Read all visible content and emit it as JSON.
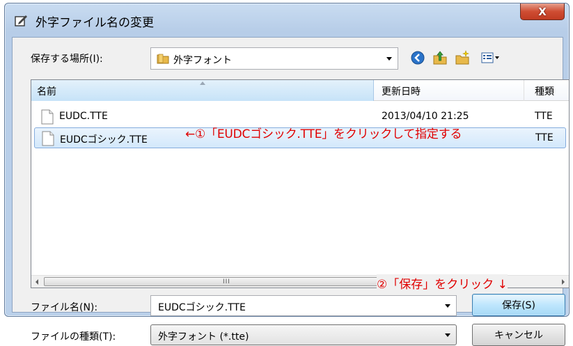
{
  "window": {
    "title": "外字ファイル名の変更",
    "close_label": "X"
  },
  "location": {
    "label": "保存する場所(I):",
    "value": "外字フォント"
  },
  "toolbar_icons": [
    "back-icon",
    "up-folder-icon",
    "new-folder-icon",
    "view-menu-icon"
  ],
  "list": {
    "columns": [
      "名前",
      "更新日時",
      "種類"
    ],
    "rows": [
      {
        "name": "EUDC.TTE",
        "date": "2013/04/10 21:25",
        "type": "TTE"
      },
      {
        "name": "EUDCゴシック.TTE",
        "date": "",
        "type": "TTE",
        "selected": true
      }
    ],
    "scroll_grip": "III"
  },
  "annotations": {
    "step1": "←①「EUDCゴシック.TTE」をクリックして指定する",
    "step2": "②「保存」をクリック ↓"
  },
  "filename": {
    "label": "ファイル名(N):",
    "value": "EUDCゴシック.TTE"
  },
  "filetype": {
    "label": "ファイルの種類(T):",
    "value": "外字フォント (*.tte)"
  },
  "buttons": {
    "save": "保存(S)",
    "cancel": "キャンセル"
  },
  "colors": {
    "annotation": "#e00000",
    "selection": "#d3e8fb",
    "close": "#c03b22"
  }
}
